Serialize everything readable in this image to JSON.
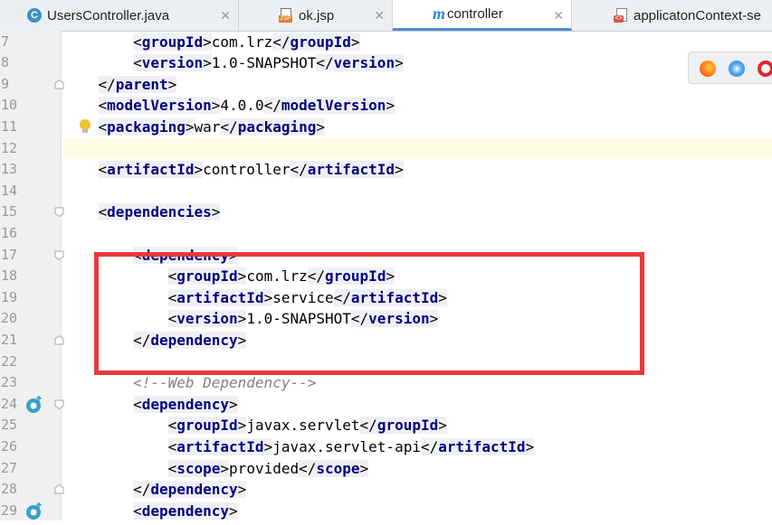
{
  "tabs": [
    {
      "label": "UsersController.java",
      "icon": "java-class-icon"
    },
    {
      "label": "ok.jsp",
      "icon": "jsp-file-icon"
    },
    {
      "label": "controller",
      "icon": "maven-icon"
    },
    {
      "label": "applicatonContext-se",
      "icon": "xml-file-icon"
    }
  ],
  "line_numbers": [
    "7",
    "8",
    "9",
    "10",
    "11",
    "12",
    "13",
    "14",
    "15",
    "16",
    "17",
    "18",
    "19",
    "20",
    "21",
    "22",
    "23",
    "24",
    "25",
    "26",
    "27",
    "28",
    "29"
  ],
  "code": {
    "l7": {
      "indent": "        ",
      "open": "groupId",
      "text": "com.lrz",
      "close": "groupId"
    },
    "l8": {
      "indent": "        ",
      "open": "version",
      "text": "1.0-SNAPSHOT",
      "close": "version"
    },
    "l9": {
      "indent": "    ",
      "close": "parent"
    },
    "l10": {
      "indent": "    ",
      "open": "modelVersion",
      "text": "4.0.0",
      "close": "modelVersion"
    },
    "l11": {
      "indent": "    ",
      "open": "packaging",
      "text": "war",
      "close": "packaging"
    },
    "l13": {
      "indent": "    ",
      "open": "artifactId",
      "text": "controller",
      "close": "artifactId"
    },
    "l15": {
      "indent": "    ",
      "open": "dependencies"
    },
    "l17": {
      "indent": "        ",
      "open": "dependency"
    },
    "l18": {
      "indent": "            ",
      "open": "groupId",
      "text": "com.lrz",
      "close": "groupId"
    },
    "l19": {
      "indent": "            ",
      "open": "artifactId",
      "text": "service",
      "close": "artifactId"
    },
    "l20": {
      "indent": "            ",
      "open": "version",
      "text": "1.0-SNAPSHOT",
      "close": "version"
    },
    "l21": {
      "indent": "        ",
      "close": "dependency"
    },
    "l23": {
      "indent": "        ",
      "comment": "<!--Web Dependency-->"
    },
    "l24": {
      "indent": "        ",
      "open": "dependency"
    },
    "l25": {
      "indent": "            ",
      "open": "groupId",
      "text": "javax.servlet",
      "close": "groupId"
    },
    "l26": {
      "indent": "            ",
      "open": "artifactId",
      "text": "javax.servlet-api",
      "close": "artifactId"
    },
    "l27": {
      "indent": "            ",
      "open": "scope",
      "text": "provided",
      "close": "scope"
    },
    "l28": {
      "indent": "        ",
      "close": "dependency"
    },
    "l29": {
      "indent": "        ",
      "open": "dependency"
    }
  },
  "browser_icons": [
    "firefox-icon",
    "safari-icon",
    "opera-icon"
  ],
  "colors": {
    "tag": "#000080",
    "comment": "#808080",
    "highlight": "#fdfbe3",
    "annotation": "#e8383d",
    "accent": "#4d8dd6"
  }
}
